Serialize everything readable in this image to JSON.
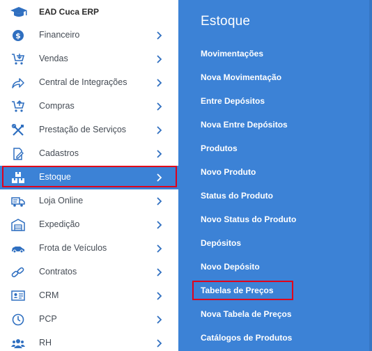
{
  "brand": {
    "name": "EAD Cuca ERP",
    "icon": "graduation-cap-icon"
  },
  "sidebar": {
    "items": [
      {
        "label": "Financeiro",
        "icon": "dollar-circle-icon"
      },
      {
        "label": "Vendas",
        "icon": "cart-download-icon"
      },
      {
        "label": "Central de Integrações",
        "icon": "share-arrow-icon"
      },
      {
        "label": "Compras",
        "icon": "cart-icon"
      },
      {
        "label": "Prestação de Serviços",
        "icon": "tools-icon"
      },
      {
        "label": "Cadastros",
        "icon": "edit-document-icon"
      },
      {
        "label": "Estoque",
        "icon": "boxes-icon",
        "active": true
      },
      {
        "label": "Loja Online",
        "icon": "truck-icon"
      },
      {
        "label": "Expedição",
        "icon": "warehouse-icon"
      },
      {
        "label": "Frota de Veículos",
        "icon": "car-icon"
      },
      {
        "label": "Contratos",
        "icon": "link-icon"
      },
      {
        "label": "CRM",
        "icon": "id-card-icon"
      },
      {
        "label": "PCP",
        "icon": "clock-icon"
      },
      {
        "label": "RH",
        "icon": "users-icon"
      }
    ]
  },
  "panel": {
    "title": "Estoque",
    "items": [
      "Movimentações",
      "Nova Movimentação",
      "Entre Depósitos",
      "Nova Entre Depósitos",
      "Produtos",
      "Novo Produto",
      "Status do Produto",
      "Novo Status do Produto",
      "Depósitos",
      "Novo Depósito",
      "Tabelas de Preços",
      "Nova Tabela de Preços",
      "Catálogos de Produtos"
    ]
  },
  "colors": {
    "accent": "#3c82d6",
    "highlight_border": "#e0001b",
    "icon_blue": "#2f6fc0",
    "text": "#444b54"
  }
}
